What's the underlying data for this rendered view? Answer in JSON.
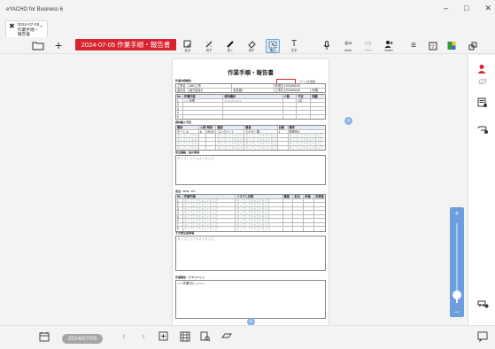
{
  "window": {
    "app_title": "eYACHO for Business 6",
    "minimize": "–",
    "maximize": "□",
    "close": "✕"
  },
  "tab": {
    "label_line1": "2024-07-05_作業手順・",
    "label_line2": "報告書",
    "close": "✖",
    "mini_close": "✕"
  },
  "toolbar": {
    "document_title": "2024-07-05 作業手順・報告書",
    "tools": [
      {
        "label": "戻る"
      },
      {
        "label": "消す"
      },
      {
        "label": "書く"
      },
      {
        "label": "消す"
      },
      {
        "label": "選ぶ"
      },
      {
        "label": "文字"
      },
      {
        "label": ""
      },
      {
        "label": "Undo"
      },
      {
        "label": "Redo"
      },
      {
        "label": "Share"
      }
    ]
  },
  "document": {
    "title": "作業手順・報告書",
    "page_setting": "ページを追加",
    "header_section": "作業内容報告",
    "work_name_label": "工事名",
    "work_name": "ABC工事",
    "company_label": "会社名",
    "company": "協力会社A",
    "manager_label": "責任者",
    "created_label": "作成日",
    "created_date": "2024/06/28",
    "date_label": "工事日",
    "date_value": "2024/06/28",
    "weather_label": "天候",
    "task_head": [
      "No",
      "作業内容",
      "使用機材",
      "人数",
      "予定",
      "実績"
    ],
    "tasks": [
      [
        "1",
        "○○○作業",
        "○○○○○○○○○○",
        "",
        "1名",
        ""
      ],
      [
        "2",
        "",
        "",
        "",
        "",
        ""
      ],
      [
        "3",
        "",
        "",
        "",
        "",
        ""
      ],
      [
        "4",
        "",
        "",
        "",
        "",
        ""
      ],
      [
        "5",
        "",
        "",
        "",
        "",
        ""
      ]
    ],
    "material_section": "資材搬入予定",
    "material_head": [
      "資材",
      "入荷",
      "時刻",
      "搬送",
      "業者",
      "台数",
      "備考"
    ],
    "materials": [
      [
        "ゲート A",
        "A",
        "09:00",
        "コンクリート",
        "ミキサー車",
        "1",
        "荷卸先A"
      ],
      [
        "タップしてテキストを入力",
        "",
        "",
        "タップしてテキストを入力",
        "タップしてテキストを入力",
        "",
        "タップしてテキストを入力"
      ],
      [
        "タップしてテキストを入力",
        "",
        "",
        "タップしてテキストを入力",
        "タップしてテキストを入力",
        "",
        "タップしてテキストを入力"
      ],
      [
        "タップしてテキストを入力",
        "",
        "",
        "タップしてテキストを入力",
        "タップしてテキストを入力",
        "",
        "タップしてテキストを入力"
      ],
      [
        "タップしてテキストを入力",
        "",
        "",
        "タップしてテキストを入力",
        "タップしてテキストを入力",
        "",
        "タップしてテキストを入力"
      ]
    ],
    "notice_section": "安全連絡・指示事項",
    "notice_placeholder": "タップしてテキストを入力",
    "ky_section": "安全・KYK・KY",
    "ky_head": [
      "No",
      "作業手順",
      "リスクと対策",
      "確認",
      "担当",
      "評価",
      "対策後"
    ],
    "ky_rows": [
      [
        "1",
        "タップしてテキストを入力",
        "タップしてテキストを入力"
      ],
      [
        "2",
        "タップしてテキストを入力",
        "タップしてテキストを入力"
      ],
      [
        "3",
        "タップしてテキストを入力",
        "タップしてテキストを入力"
      ],
      [
        "4",
        "タップしてテキストを入力",
        "タップしてテキストを入力"
      ],
      [
        "5",
        "タップしてテキストを入力",
        "タップしてテキストを入力"
      ],
      [
        "6",
        "タップしてテキストを入力",
        "タップしてテキストを入力"
      ],
      [
        "7",
        "タップしてテキストを入力",
        "タップしてテキストを入力"
      ],
      [
        "8",
        "タップしてテキストを入力",
        "タップしてテキストを入力"
      ]
    ],
    "ky_points_section": "その他注意事項",
    "ky_points_placeholder": "タップしてテキストを入力",
    "footer_section": "作業報告・ヒヤリハット",
    "footer_value": "○○○作業中に○○○○○"
  },
  "zoom": {
    "plus": "+",
    "minus": "−",
    "level": 0.1
  },
  "bottombar": {
    "date": "2024/07/05",
    "prev": "‹",
    "next": "›"
  },
  "page_add": "+"
}
